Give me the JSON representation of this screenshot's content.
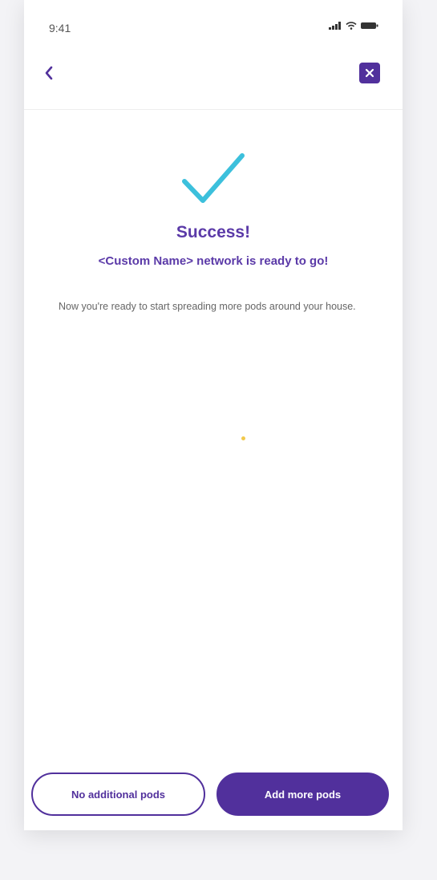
{
  "status_bar": {
    "time": "9:41",
    "icons": [
      "signal-icon",
      "wifi-icon",
      "battery-icon"
    ]
  },
  "nav": {
    "back_icon": "chevron-left-icon",
    "close_icon": "close-icon"
  },
  "content": {
    "check_icon": "checkmark-icon",
    "title": "Success!",
    "subtitle": "<Custom Name> network is ready to go!",
    "body": "Now you're ready to start spreading more pods around your house."
  },
  "footer": {
    "secondary_label": "No additional pods",
    "primary_label": "Add more pods"
  },
  "colors": {
    "brand": "#51309c",
    "title": "#5b3aa8",
    "check": "#3cc0dc"
  }
}
